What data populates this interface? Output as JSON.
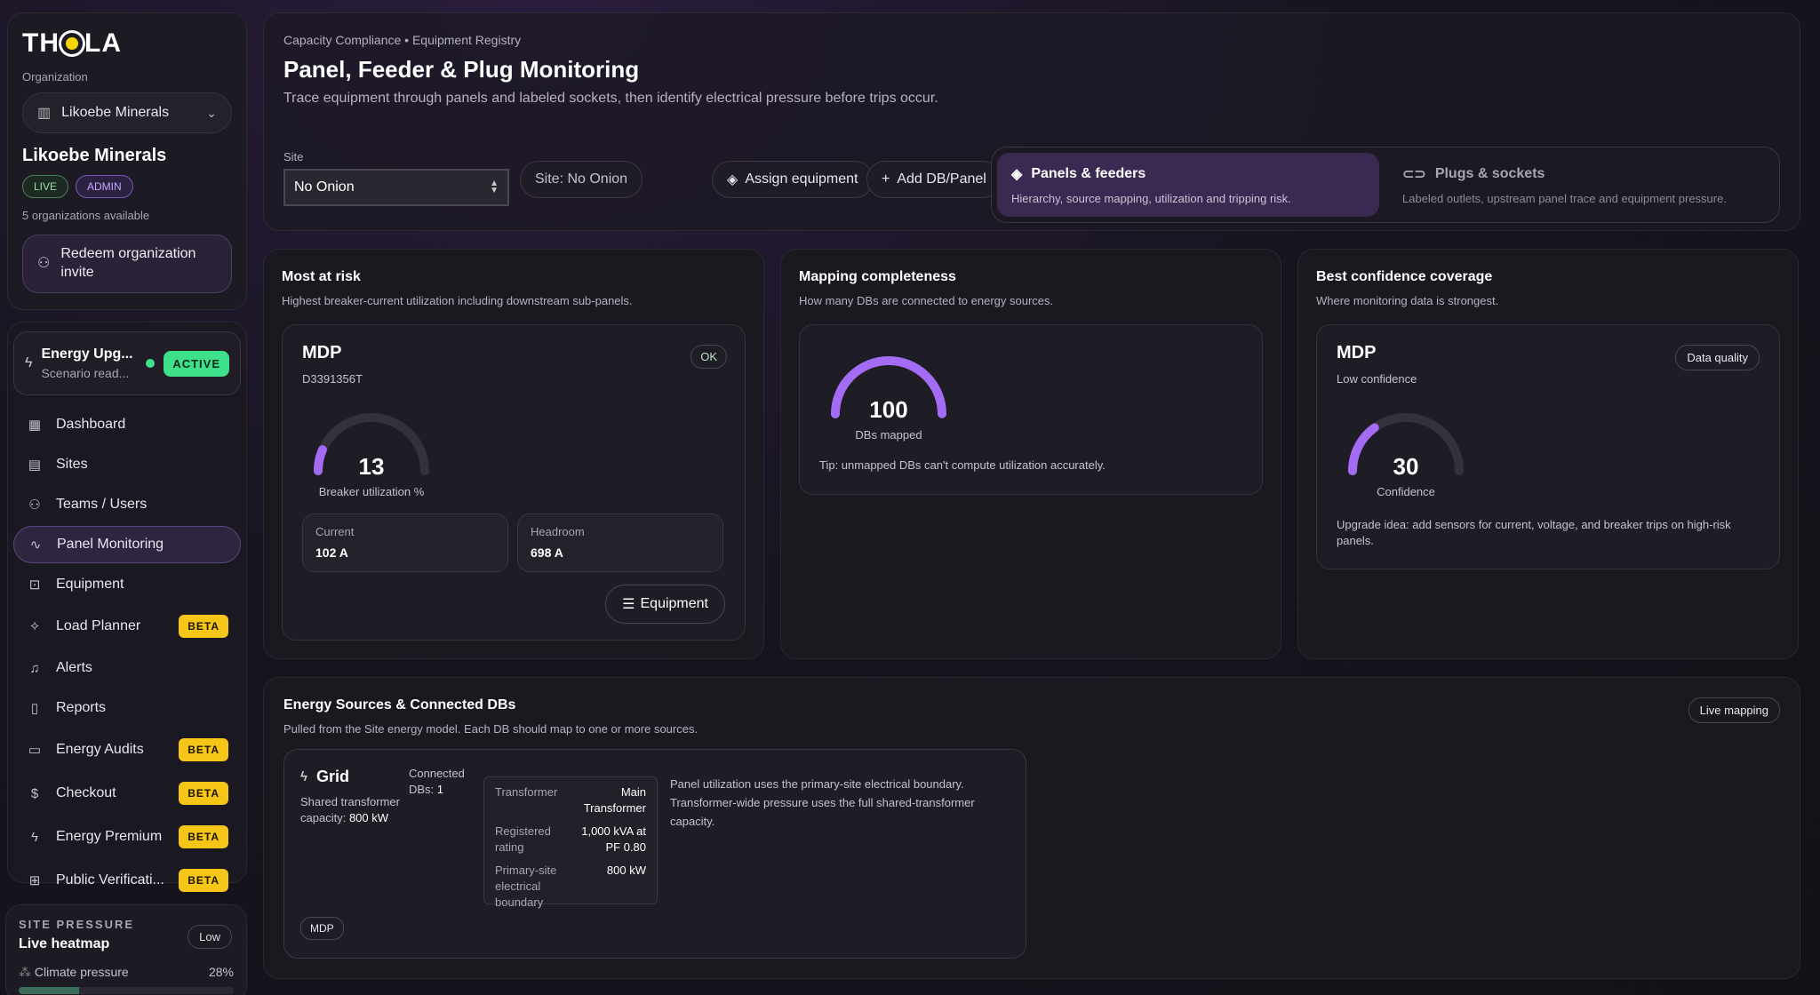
{
  "brand": {
    "logo": "THOLA"
  },
  "org": {
    "label": "Organization",
    "selected": "Likoebe Minerals",
    "name": "Likoebe Minerals",
    "badge_live": "LIVE",
    "badge_admin": "ADMIN",
    "available": "5 organizations available",
    "redeem": "Redeem organization invite"
  },
  "scenario": {
    "title": "Energy Upg...",
    "subtitle": "Scenario read...",
    "status": "ACTIVE"
  },
  "nav": [
    {
      "label": "Dashboard",
      "icon": "dashboard-icon",
      "glyph": "▦",
      "beta": ""
    },
    {
      "label": "Sites",
      "icon": "chart-icon",
      "glyph": "▤",
      "beta": ""
    },
    {
      "label": "Teams / Users",
      "icon": "users-icon",
      "glyph": "⚇",
      "beta": ""
    },
    {
      "label": "Panel Monitoring",
      "icon": "pulse-icon",
      "glyph": "∿",
      "beta": ""
    },
    {
      "label": "Equipment",
      "icon": "cpu-icon",
      "glyph": "⊡",
      "beta": ""
    },
    {
      "label": "Load Planner",
      "icon": "sparkle-icon",
      "glyph": "✧",
      "beta": "BETA"
    },
    {
      "label": "Alerts",
      "icon": "bell-icon",
      "glyph": "♫",
      "beta": ""
    },
    {
      "label": "Reports",
      "icon": "file-icon",
      "glyph": "▯",
      "beta": ""
    },
    {
      "label": "Energy Audits",
      "icon": "clipboard-icon",
      "glyph": "▭",
      "beta": "BETA"
    },
    {
      "label": "Checkout",
      "icon": "dollar-icon",
      "glyph": "$",
      "beta": "BETA"
    },
    {
      "label": "Energy Premium",
      "icon": "bolt-icon",
      "glyph": "ϟ",
      "beta": "BETA"
    },
    {
      "label": "Public Verificati...",
      "icon": "qr-icon",
      "glyph": "⊞",
      "beta": "BETA"
    }
  ],
  "pressure": {
    "caption": "SITE PRESSURE",
    "title": "Live heatmap",
    "level": "Low",
    "metric": "Climate pressure",
    "value": "28%",
    "fraction": 0.28
  },
  "header": {
    "breadcrumb": "Capacity Compliance • Equipment Registry",
    "title": "Panel, Feeder & Plug Monitoring",
    "subtitle": "Trace equipment through panels and labeled sockets, then identify electrical pressure before trips occur.",
    "site_label": "Site",
    "site_value": "No Onion",
    "site_chip": "Site: No Onion",
    "assign": "Assign equipment",
    "add": "Add DB/Panel",
    "tabs": [
      {
        "title": "Panels & feeders",
        "desc": "Hierarchy, source mapping, utilization and tripping risk."
      },
      {
        "title": "Plugs & sockets",
        "desc": "Labeled outlets, upstream panel trace and equipment pressure."
      }
    ]
  },
  "risk": {
    "title": "Most at risk",
    "subtitle": "Highest breaker-current utilization including downstream sub-panels.",
    "panel": "MDP",
    "code": "D3391356T",
    "status": "OK",
    "value": "13",
    "value_num": 13,
    "caption": "Breaker utilization %",
    "current_label": "Current",
    "current_value": "102 A",
    "headroom_label": "Headroom",
    "headroom_value": "698 A",
    "button": "Equipment"
  },
  "mapping": {
    "title": "Mapping completeness",
    "subtitle": "How many DBs are connected to energy sources.",
    "value": "100",
    "value_num": 100,
    "caption": "DBs mapped",
    "tip": "Tip: unmapped DBs can't compute utilization accurately."
  },
  "confidence": {
    "title": "Best confidence coverage",
    "subtitle": "Where monitoring data is strongest.",
    "panel": "MDP",
    "tag": "Data quality",
    "level": "Low confidence",
    "value": "30",
    "value_num": 30,
    "caption": "Confidence",
    "note": "Upgrade idea: add sensors for current, voltage, and breaker trips on high-risk panels."
  },
  "sources": {
    "title": "Energy Sources & Connected DBs",
    "subtitle": "Pulled from the Site energy model. Each DB should map to one or more sources.",
    "tag": "Live mapping",
    "grid": {
      "name": "Grid",
      "shared_label": "Shared transformer capacity:",
      "shared_value": "800 kW",
      "connected_label": "Connected DBs:",
      "connected_value": "1",
      "rows": [
        {
          "k": "Transformer",
          "v": "Main Transformer"
        },
        {
          "k": "Registered rating",
          "v": "1,000 kVA at PF 0.80"
        },
        {
          "k": "Primary-site electrical boundary",
          "v": "800 kW"
        }
      ],
      "note": "Panel utilization uses the primary-site electrical boundary. Transformer-wide pressure uses the full shared-transformer capacity.",
      "db": "MDP"
    }
  },
  "colors": {
    "accent": "#a46bf5",
    "active_green": "#3ee08a",
    "beta_yellow": "#f5c518",
    "track": "#34313b"
  }
}
